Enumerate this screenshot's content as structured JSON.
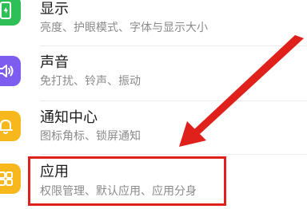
{
  "settings": {
    "items": [
      {
        "title": "显示",
        "subtitle": "亮度、护眼模式、字体与显示大小",
        "icon": "display-icon",
        "color": "#2fbf57"
      },
      {
        "title": "声音",
        "subtitle": "免打扰、铃声、振动",
        "icon": "sound-icon",
        "color": "#7d5cf0"
      },
      {
        "title": "通知中心",
        "subtitle": "图标角标、锁屏通知",
        "icon": "bell-icon",
        "color": "#f6b81c"
      },
      {
        "title": "应用",
        "subtitle": "权限管理、默认应用、应用分身",
        "icon": "apps-icon",
        "color": "#f6b81c"
      }
    ]
  },
  "annotation": {
    "color": "#e0201b"
  }
}
